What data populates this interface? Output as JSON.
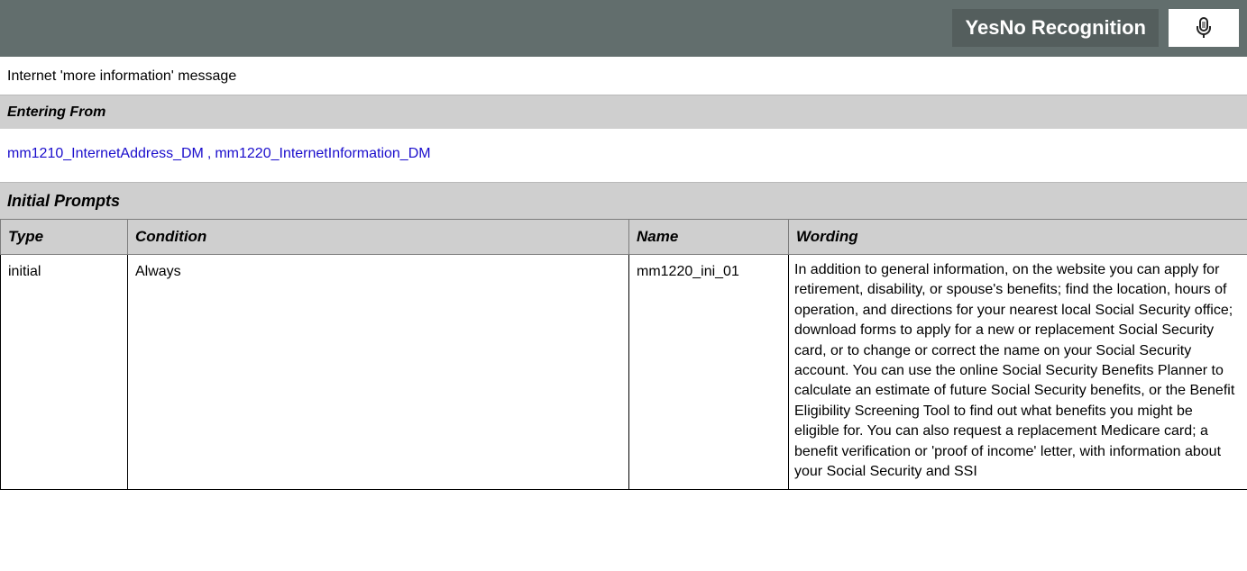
{
  "header": {
    "title": "YesNo Recognition",
    "mic_icon": "microphone-icon"
  },
  "description": "Internet 'more information' message",
  "entering_from": {
    "heading": "Entering From",
    "links": [
      "mm1210_InternetAddress_DM",
      "mm1220_InternetInformation_DM"
    ],
    "separator": ","
  },
  "initial_prompts": {
    "heading": "Initial Prompts",
    "columns": [
      "Type",
      "Condition",
      "Name",
      "Wording"
    ],
    "rows": [
      {
        "type": "initial",
        "condition": "Always",
        "name": "mm1220_ini_01",
        "wording": "In addition to general information, on the website you can apply for retirement, disability, or spouse's benefits; find the location, hours of operation, and directions for your nearest local Social Security office; download forms to apply for a new or replacement Social Security card, or to change or correct the name on your Social Security account. You can use the online Social Security Benefits Planner  to calculate an estimate of future Social Security benefits, or the Benefit Eligibility Screening Tool to find out what benefits you might be eligible for. You can also request a replacement Medicare card; a benefit verification or 'proof of income' letter, with information about your Social Security and SSI"
      }
    ]
  },
  "colors": {
    "title_bar": "#626e6d",
    "section_header": "#cfcfcf",
    "link": "#1a0dcc"
  }
}
